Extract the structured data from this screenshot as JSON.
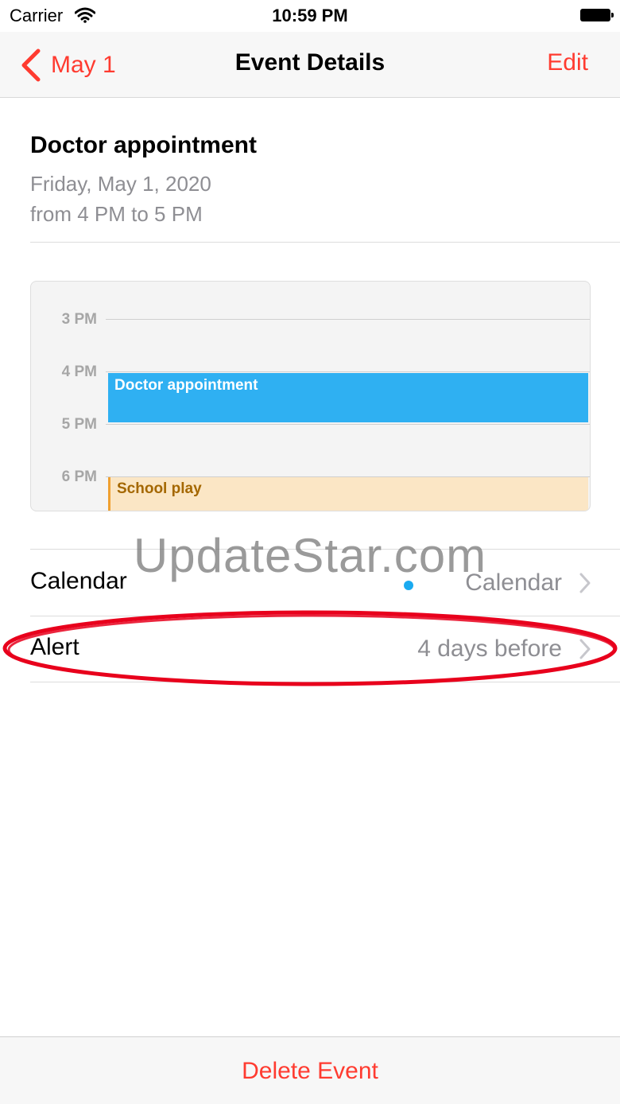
{
  "status_bar": {
    "carrier": "Carrier",
    "time": "10:59 PM",
    "icons": [
      "wifi-icon",
      "battery-icon"
    ]
  },
  "nav": {
    "back_label": "May 1",
    "title": "Event Details",
    "edit_label": "Edit"
  },
  "event": {
    "title": "Doctor appointment",
    "date": "Friday, May 1, 2020",
    "time_range": "from 4 PM to 5 PM"
  },
  "day_preview": {
    "hours": [
      "3 PM",
      "4 PM",
      "5 PM",
      "6 PM"
    ],
    "events": [
      {
        "title": "Doctor appointment",
        "color": "#2fb0f2"
      },
      {
        "title": "School play",
        "color": "#fbe6c5"
      }
    ]
  },
  "rows": {
    "calendar": {
      "label": "Calendar",
      "value": "Calendar",
      "dot_color": "#1aaaf0"
    },
    "alert": {
      "label": "Alert",
      "value": "4 days before"
    }
  },
  "watermark": "UpdateStar.com",
  "toolbar": {
    "delete_label": "Delete Event"
  },
  "colors": {
    "accent": "#ff3b30",
    "secondary_text": "#8e8e93",
    "highlight": "#e8001c"
  }
}
